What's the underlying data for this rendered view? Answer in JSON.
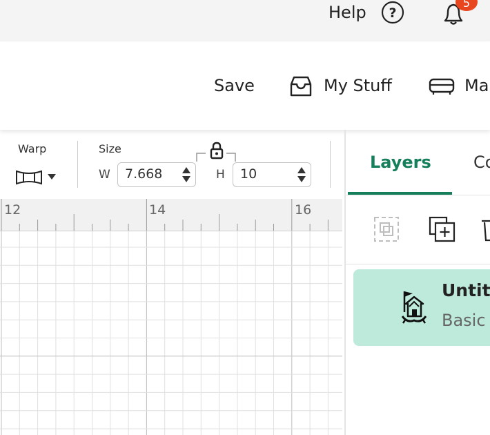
{
  "topbar": {
    "help_label": "Help",
    "help_icon": "question-circle-icon",
    "notifications_icon": "bell-icon",
    "notifications_count": "5",
    "badge_color": "#e8461e"
  },
  "header": {
    "save_label": "Save",
    "my_stuff_label": "My Stuff",
    "my_stuff_icon": "inbox-tray-icon",
    "make_label": "Ma",
    "make_icon": "machine-icon"
  },
  "toolbar": {
    "warp_label": "Warp",
    "warp_icon": "warp-shape-icon",
    "size_label": "Size",
    "width_label": "W",
    "width_value": "7.668",
    "height_label": "H",
    "height_value": "10",
    "lock_icon": "padlock-icon"
  },
  "ruler": {
    "labels": [
      "12",
      "14",
      "16"
    ]
  },
  "panel": {
    "tabs": [
      {
        "label": "Layers",
        "active": true
      },
      {
        "label": "Co",
        "active": false
      }
    ],
    "accent_color": "#157f5c",
    "actions": [
      "group-icon",
      "duplicate-icon",
      "delete-icon"
    ],
    "layer": {
      "title": "Untitl",
      "subtitle": "Basic",
      "card_color": "#bdeadb"
    }
  }
}
